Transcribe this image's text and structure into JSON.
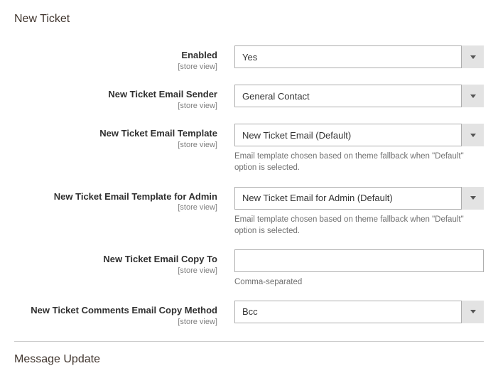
{
  "section1_title": "New Ticket",
  "scope_label": "[store view]",
  "fields": {
    "enabled": {
      "label": "Enabled",
      "value": "Yes"
    },
    "sender": {
      "label": "New Ticket Email Sender",
      "value": "General Contact"
    },
    "template": {
      "label": "New Ticket Email Template",
      "value": "New Ticket Email (Default)",
      "help": "Email template chosen based on theme fallback when \"Default\" option is selected."
    },
    "template_admin": {
      "label": "New Ticket Email Template for Admin",
      "value": "New Ticket Email for Admin (Default)",
      "help": "Email template chosen based on theme fallback when \"Default\" option is selected."
    },
    "copy_to": {
      "label": "New Ticket Email Copy To",
      "value": "",
      "help": "Comma-separated"
    },
    "copy_method": {
      "label": "New Ticket Comments Email Copy Method",
      "value": "Bcc"
    }
  },
  "section2_title": "Message Update"
}
